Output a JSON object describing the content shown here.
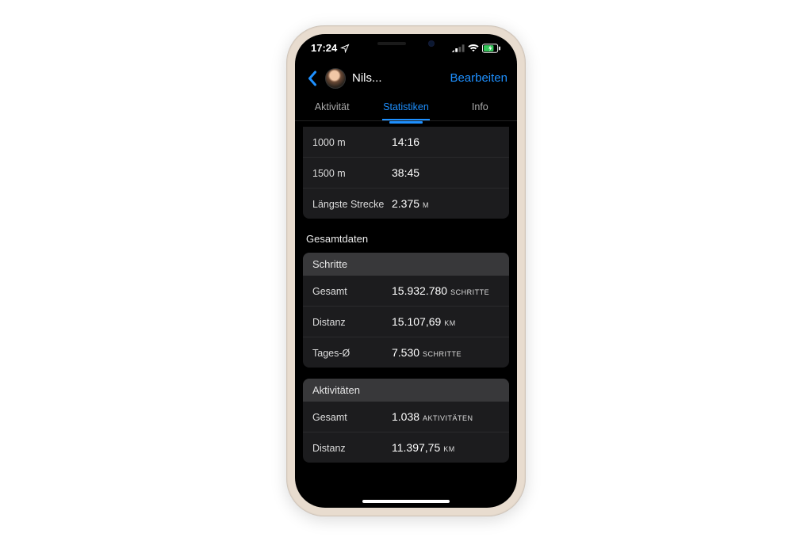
{
  "status": {
    "time": "17:24"
  },
  "nav": {
    "name": "Nils...",
    "edit": "Bearbeiten"
  },
  "tabs": {
    "activity": "Aktivität",
    "stats": "Statistiken",
    "info": "Info"
  },
  "records": [
    {
      "label": "1000 m",
      "value": "14:16",
      "unit": ""
    },
    {
      "label": "1500 m",
      "value": "38:45",
      "unit": ""
    },
    {
      "label": "Längste Strecke",
      "value": "2.375",
      "unit": "M"
    }
  ],
  "totalsTitle": "Gesamtdaten",
  "steps": {
    "header": "Schritte",
    "rows": [
      {
        "label": "Gesamt",
        "value": "15.932.780",
        "unit": "SCHRITTE"
      },
      {
        "label": "Distanz",
        "value": "15.107,69",
        "unit": "KM"
      },
      {
        "label": "Tages-Ø",
        "value": "7.530",
        "unit": "SCHRITTE"
      }
    ]
  },
  "activities": {
    "header": "Aktivitäten",
    "rows": [
      {
        "label": "Gesamt",
        "value": "1.038",
        "unit": "AKTIVITÄTEN"
      },
      {
        "label": "Distanz",
        "value": "11.397,75",
        "unit": "KM"
      }
    ]
  }
}
